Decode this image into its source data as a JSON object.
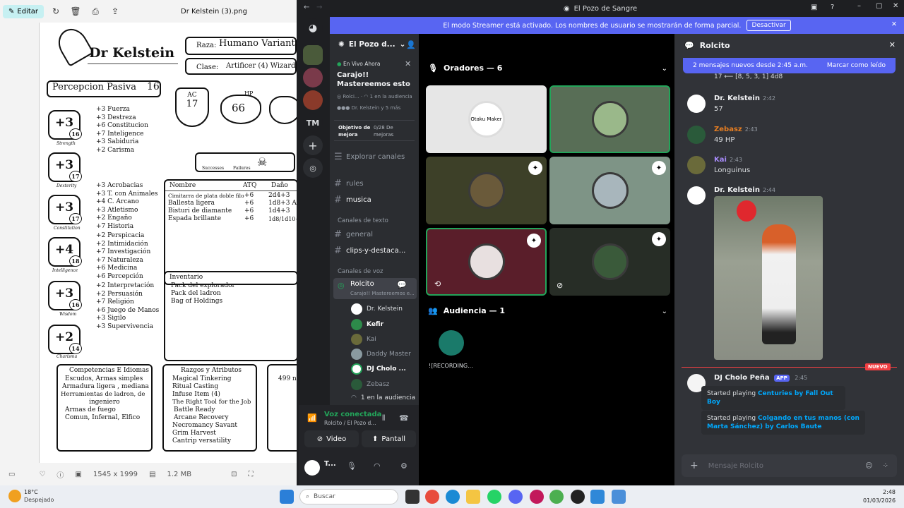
{
  "viewer": {
    "edit_label": "Editar",
    "filename": "Dr Kelstein (3).png",
    "dimensions": "1545 x 1999",
    "size": "1.2 MB"
  },
  "sheet": {
    "name": "Dr Kelstein",
    "race_label": "Raza:",
    "race": "Humano Variante",
    "class_label": "Clase:",
    "class": "Artificer (4) Wizard (4)",
    "passive_label": "Percepcion Pasiva",
    "passive": "16",
    "ac_label": "AC",
    "ac": "17",
    "hp_label": "HP",
    "hp": "66",
    "saves": [
      "+3 Fuerza",
      "+3 Destreza",
      "+6 Constitucion",
      "+7 Inteligence",
      "+3 Sabiduria",
      "+2 Carisma"
    ],
    "death_successes": "Successes",
    "death_failures": "Failures",
    "abilities": [
      {
        "mod": "+3",
        "score": "16",
        "label": "Strength"
      },
      {
        "mod": "+3",
        "score": "17",
        "label": "Dexterity"
      },
      {
        "mod": "+3",
        "score": "17",
        "label": "Constitution"
      },
      {
        "mod": "+4",
        "score": "18",
        "label": "Intelligence"
      },
      {
        "mod": "+3",
        "score": "16",
        "label": "Wisdom"
      },
      {
        "mod": "+2",
        "score": "14",
        "label": "Charisma"
      }
    ],
    "skills": [
      "+3 Acrobacias",
      "+3 T. con Animales",
      "+4 C. Arcano",
      "+3 Atletismo",
      "+2 Engaño",
      "+7 Historia",
      "+2 Perspicacia",
      "+2 Intimidación",
      "+7 Investigación",
      "+7 Naturaleza",
      "+6 Medicina",
      "+6 Percepción",
      "+2 Interpretación",
      "+2 Persuasión",
      "+7 Religión",
      "+6 Juego de Manos",
      "+3 Sigilo",
      "+3 Supervivencia"
    ],
    "weapons_headers": [
      "Nombre",
      "ATQ",
      "Daño"
    ],
    "weapons": [
      [
        "Cimitarra de plata doble filo",
        "+6",
        "2d4+3"
      ],
      [
        "Ballesta ligera",
        "+6",
        "1d8+3 A"
      ],
      [
        "Bisturi de diamante",
        "+6",
        "1d4+3"
      ],
      [
        "Espada brillante",
        "+6",
        "1d8/1d10+"
      ]
    ],
    "inventory_title": "Inventario",
    "inventory": [
      "Pack del explorador",
      "Pack del ladron",
      "Bag of Holdings"
    ],
    "competencies_title": "Competencias E Idiomas",
    "competencies": [
      "Escudos, Armas simples",
      "Armadura ligera , mediana",
      "Herramientas de ladron, de",
      "ingeniero",
      "Armas de fuego",
      "Comun, Infernal, Elfico"
    ],
    "traits_title": "Razgos y Atributos",
    "traits": [
      "Magical Tinkering",
      "Ritual Casting",
      "Infuse Item (4)",
      "The Right Tool for the Job",
      "Battle Ready",
      "Arcane Recovery",
      "Necromancy Savant",
      "Grim Harvest",
      "Cantrip versatility"
    ],
    "extra_value": "499 n"
  },
  "discord": {
    "window_title": "El Pozo de Sangre",
    "banner_text": "El modo Streamer está activado. Los nombres de usuario se mostrarán de forma parcial.",
    "banner_button": "Desactivar",
    "guild_label_tm": "TM",
    "server_name": "El Pozo d...",
    "live_label": "En Vivo Ahora",
    "event_title": "Carajo!! Mastereemos esto",
    "event_channel": "Rolci...",
    "event_audience": "1 en la audiencia",
    "event_people": "Dr. Kelstein y 5 más",
    "boost_label": "Objetivo de mejora",
    "boost_value": "0/28 De mejoras",
    "explore": "Explorar canales",
    "channels_top": [
      "rules",
      "musica"
    ],
    "text_category": "Canales de texto",
    "text_channels": [
      "general",
      "clips-y-destaca..."
    ],
    "voice_category": "Canales de voz",
    "voice_channel": "Rolcito",
    "voice_topic": "Carajo!! Mastereemos e...",
    "voice_users": [
      {
        "name": "Dr. Kelstein",
        "color": "#dbdee1"
      },
      {
        "name": "Kefir",
        "color": "#ffffff"
      },
      {
        "name": "Kai",
        "color": "#949ba4"
      },
      {
        "name": "Daddy Master",
        "color": "#949ba4"
      },
      {
        "name": "DJ Cholo ...",
        "color": "#ffffff"
      },
      {
        "name": "Zebasz",
        "color": "#949ba4"
      }
    ],
    "voice_audience": "1 en la audiencia",
    "voice_status": "Voz conectada",
    "voice_location": "Rolcito / El Pozo d...",
    "video_label": "Video",
    "screen_label": "Pantall",
    "user_short": "T...",
    "stage": {
      "speakers_title": "Oradores — 6",
      "audience_title": "Audiencia — 1",
      "audience_member": "![RECORDING...",
      "tile_logo_text": "Otaku Maker"
    },
    "chat": {
      "channel": "Rolcito",
      "new_messages": "2 mensajes nuevos desde 2:45 a.m.",
      "mark_read": "Marcar como leído",
      "partial_line": "17  ⟵ [8, 5, 3, 1] 4d8",
      "messages": [
        {
          "author": "Dr. Kelstein",
          "time": "2:42",
          "text": "57",
          "color": "#f2f3f5"
        },
        {
          "author": "Zebasz",
          "time": "2:43",
          "text": "49 HP",
          "color": "#e67e22"
        },
        {
          "author": "Kai",
          "time": "2:43",
          "text": "Longuinus",
          "color": "#a78bfa"
        },
        {
          "author": "Dr. Kelstein",
          "time": "2:44",
          "text": "",
          "color": "#f2f3f5"
        }
      ],
      "new_tag": "NUEVO",
      "dj_name": "DJ Cholo Peña",
      "app_tag": "APP",
      "dj_time": "2:45",
      "embeds": [
        {
          "prefix": "Started playing ",
          "link": "Centuries by Fall Out Boy"
        },
        {
          "prefix": "Started playing ",
          "link": "Colgando en tus manos (con Marta Sánchez) by Carlos Baute"
        }
      ],
      "composer_placeholder": "Mensaje Rolcito"
    }
  },
  "taskbar": {
    "weather_temp": "18°C",
    "weather_desc": "Despejado",
    "search_placeholder": "Buscar",
    "time": "2:48",
    "date": "01/03/2026"
  }
}
